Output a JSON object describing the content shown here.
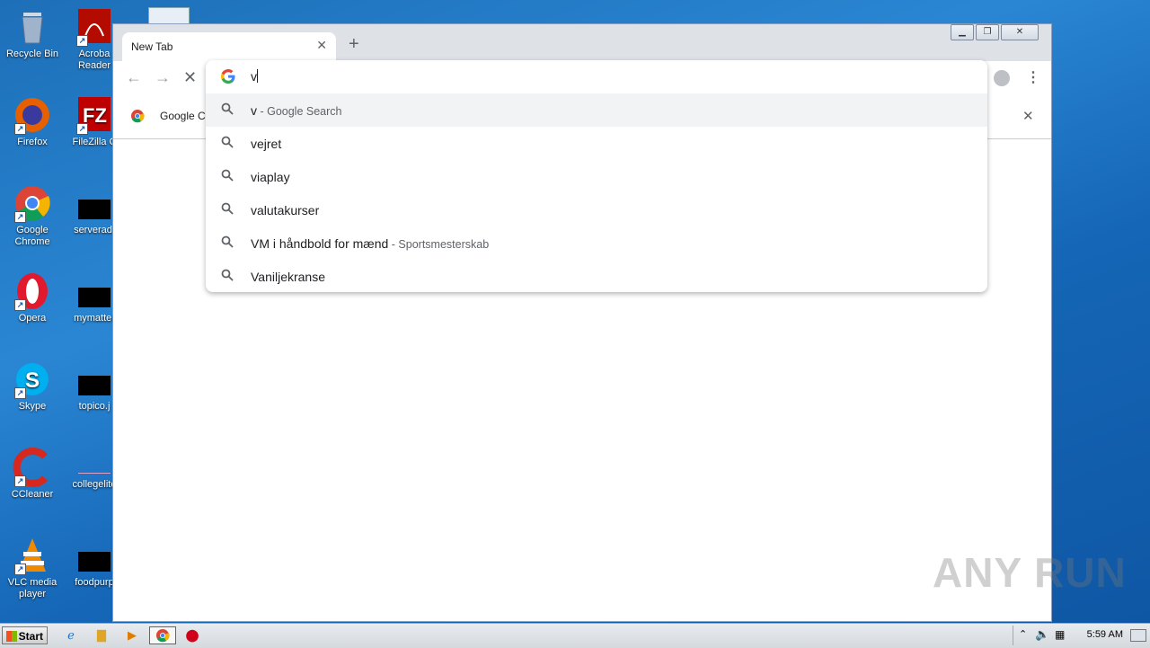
{
  "desktop": {
    "icons_col1": [
      {
        "label": "Recycle Bin",
        "icon": "recycle-bin-icon"
      },
      {
        "label": "Firefox",
        "icon": "firefox-icon"
      },
      {
        "label": "Google Chrome",
        "icon": "chrome-icon"
      },
      {
        "label": "Opera",
        "icon": "opera-icon"
      },
      {
        "label": "Skype",
        "icon": "skype-icon"
      },
      {
        "label": "CCleaner",
        "icon": "ccleaner-icon"
      },
      {
        "label": "VLC media player",
        "icon": "vlc-icon"
      }
    ],
    "icons_col2": [
      {
        "label": "Acroba Reader",
        "icon": "acrobat-icon"
      },
      {
        "label": "FileZilla C",
        "icon": "filezilla-icon"
      },
      {
        "label": "serveradı",
        "icon": "file-icon"
      },
      {
        "label": "mymatter",
        "icon": "file-icon"
      },
      {
        "label": "topico.j",
        "icon": "file-icon"
      },
      {
        "label": "collegelite",
        "icon": "file-icon"
      },
      {
        "label": "foodpurp",
        "icon": "file-icon"
      }
    ]
  },
  "browser": {
    "tab_title": "New Tab",
    "tab_close": "✕",
    "new_tab": "+",
    "bookmark_label": "Google Cl",
    "bookmark_close": "✕",
    "window_controls": [
      "▁",
      "❐",
      "✕"
    ]
  },
  "omnibox": {
    "input_value": "v",
    "suggestions": [
      {
        "text": "v",
        "desc": " - Google Search",
        "selected": true
      },
      {
        "text": "vejret",
        "desc": "",
        "selected": false
      },
      {
        "text": "viaplay",
        "desc": "",
        "selected": false
      },
      {
        "text": "valutakurser",
        "desc": "",
        "selected": false
      },
      {
        "text": "VM i håndbold for mænd",
        "desc": " - Sportsmesterskab",
        "selected": false
      },
      {
        "text": "Vaniljekranse",
        "desc": "",
        "selected": false
      }
    ]
  },
  "taskbar": {
    "start_label": "Start",
    "clock": "5:59 AM"
  },
  "watermark": "ANY RUN",
  "colors": {
    "desktop_blue": "#1d6fb8",
    "tab_strip": "#dee1e6",
    "selected_suggestion": "#f1f3f4"
  }
}
